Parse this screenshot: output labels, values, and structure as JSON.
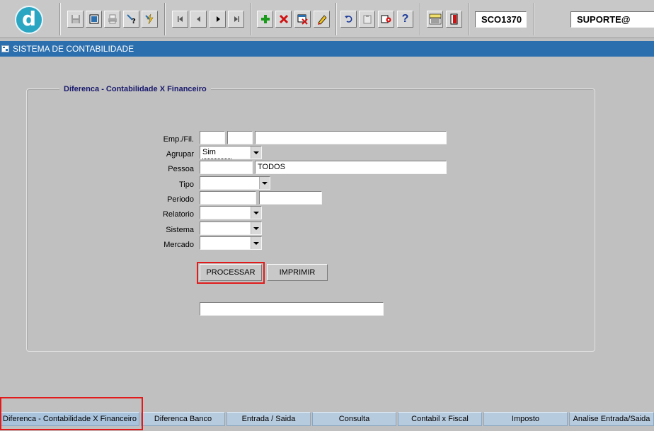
{
  "toolbar": {
    "logo_letter": "d",
    "module_code": "SCO1370",
    "user": "SUPORTE@",
    "buttons": [
      {
        "name": "save-icon"
      },
      {
        "name": "window-icon"
      },
      {
        "name": "print-icon"
      },
      {
        "name": "query-icon"
      },
      {
        "name": "execute-query-icon"
      },
      {
        "name": "first-record-icon"
      },
      {
        "name": "previous-record-icon"
      },
      {
        "name": "next-record-icon"
      },
      {
        "name": "last-record-icon"
      },
      {
        "name": "insert-record-icon"
      },
      {
        "name": "delete-record-icon"
      },
      {
        "name": "clear-record-icon"
      },
      {
        "name": "edit-icon"
      },
      {
        "name": "undo-icon"
      },
      {
        "name": "clipboard-icon"
      },
      {
        "name": "settings-icon"
      },
      {
        "name": "help-icon"
      },
      {
        "name": "menu-icon"
      },
      {
        "name": "exit-icon"
      }
    ]
  },
  "window": {
    "title": "SISTEMA DE CONTABILIDADE"
  },
  "form": {
    "section_title": "Diferenca - Contabilidade X Financeiro",
    "emp_fil_label": "Emp./Fil.",
    "emp_value": "",
    "fil_value": "",
    "emp_name_value": "",
    "agrupar_label": "Agrupar",
    "agrupar_value": "Sim",
    "pessoa_label": "Pessoa",
    "pessoa_code_value": "",
    "pessoa_name_value": "TODOS",
    "tipo_label": "Tipo",
    "tipo_value": "",
    "periodo_label": "Periodo",
    "periodo_start_value": "",
    "periodo_end_value": "",
    "relatorio_label": "Relatorio",
    "relatorio_value": "",
    "sistema_label": "Sistema",
    "sistema_value": "",
    "mercado_label": "Mercado",
    "mercado_value": "",
    "processar_label": "PROCESSAR",
    "imprimir_label": "IMPRIMIR",
    "status_value": ""
  },
  "tabs": [
    {
      "label": "Diferenca - Contabilidade X Financeiro",
      "active": true
    },
    {
      "label": "Diferenca Banco"
    },
    {
      "label": "Entrada / Saida"
    },
    {
      "label": "Consulta"
    },
    {
      "label": "Contabil x Fiscal"
    },
    {
      "label": "Imposto"
    },
    {
      "label": "Analise Entrada/Saida"
    }
  ],
  "colors": {
    "title_bar": "#2b6fae",
    "highlight": "#e11b1b",
    "tab": "#b7cbdf"
  }
}
